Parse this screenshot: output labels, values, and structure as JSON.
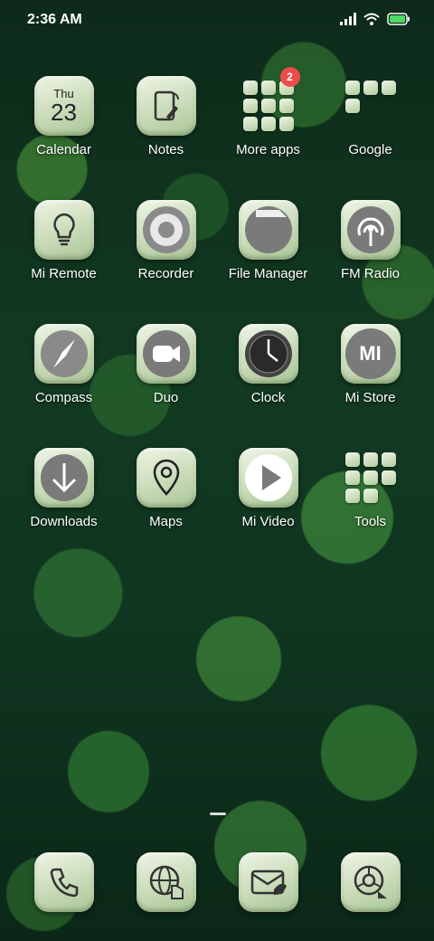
{
  "status_bar": {
    "time": "2:36 AM",
    "signal_icon": "cellular-signal-icon",
    "wifi_icon": "wifi-icon",
    "battery_icon": "battery-icon",
    "battery_color": "#4cd964"
  },
  "home": {
    "row1": [
      {
        "label": "Calendar",
        "day": "Thu",
        "date": "23",
        "icon": "calendar-icon"
      },
      {
        "label": "Notes",
        "icon": "notes-icon"
      },
      {
        "label": "More apps",
        "icon": "folder-icon",
        "badge": "2"
      },
      {
        "label": "Google",
        "icon": "folder-icon"
      }
    ],
    "row2": [
      {
        "label": "Mi Remote",
        "icon": "lightbulb-icon"
      },
      {
        "label": "Recorder",
        "icon": "record-icon"
      },
      {
        "label": "File Manager",
        "icon": "folder-file-icon"
      },
      {
        "label": "FM Radio",
        "icon": "radio-icon"
      }
    ],
    "row3": [
      {
        "label": "Compass",
        "icon": "compass-icon"
      },
      {
        "label": "Duo",
        "icon": "video-camera-icon"
      },
      {
        "label": "Clock",
        "icon": "clock-icon"
      },
      {
        "label": "Mi Store",
        "icon": "mi-logo-icon",
        "logo_text": "MI"
      }
    ],
    "row4": [
      {
        "label": "Downloads",
        "icon": "download-arrow-icon"
      },
      {
        "label": "Maps",
        "icon": "map-pin-icon"
      },
      {
        "label": "Mi Video",
        "icon": "play-icon"
      },
      {
        "label": "Tools",
        "icon": "folder-icon"
      }
    ]
  },
  "dock": [
    {
      "icon": "phone-icon"
    },
    {
      "icon": "browser-globe-icon"
    },
    {
      "icon": "messages-icon"
    },
    {
      "icon": "camera-shutter-icon"
    }
  ],
  "badge_color": "#ee4b4b"
}
